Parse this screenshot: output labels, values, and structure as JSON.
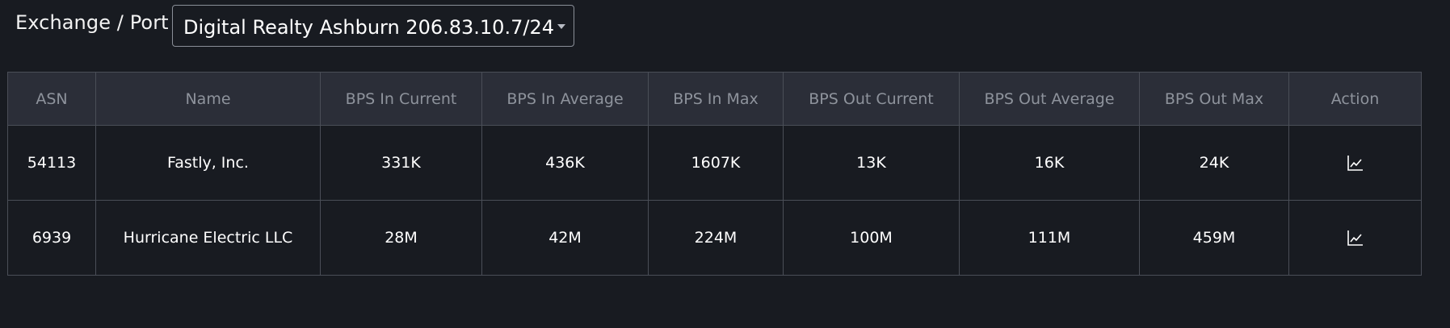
{
  "filter": {
    "label": "Exchange / Port",
    "selected": "Digital Realty Ashburn 206.83.10.7/24"
  },
  "table": {
    "columns": [
      "ASN",
      "Name",
      "BPS In Current",
      "BPS In Average",
      "BPS In Max",
      "BPS Out Current",
      "BPS Out Average",
      "BPS Out Max",
      "Action"
    ],
    "rows": [
      {
        "asn": "54113",
        "name": "Fastly, Inc.",
        "bps_in_current": "331K",
        "bps_in_average": "436K",
        "bps_in_max": "1607K",
        "bps_out_current": "13K",
        "bps_out_average": "16K",
        "bps_out_max": "24K",
        "action_icon": "chart-line-icon"
      },
      {
        "asn": "6939",
        "name": "Hurricane Electric LLC",
        "bps_in_current": "28M",
        "bps_in_average": "42M",
        "bps_in_max": "224M",
        "bps_out_current": "100M",
        "bps_out_average": "111M",
        "bps_out_max": "459M",
        "action_icon": "chart-line-icon"
      }
    ]
  },
  "colors": {
    "background": "#181b21",
    "header_background": "#2b2e38",
    "header_text": "#8e939c",
    "border": "#4a4e57",
    "text": "#ffffff"
  }
}
